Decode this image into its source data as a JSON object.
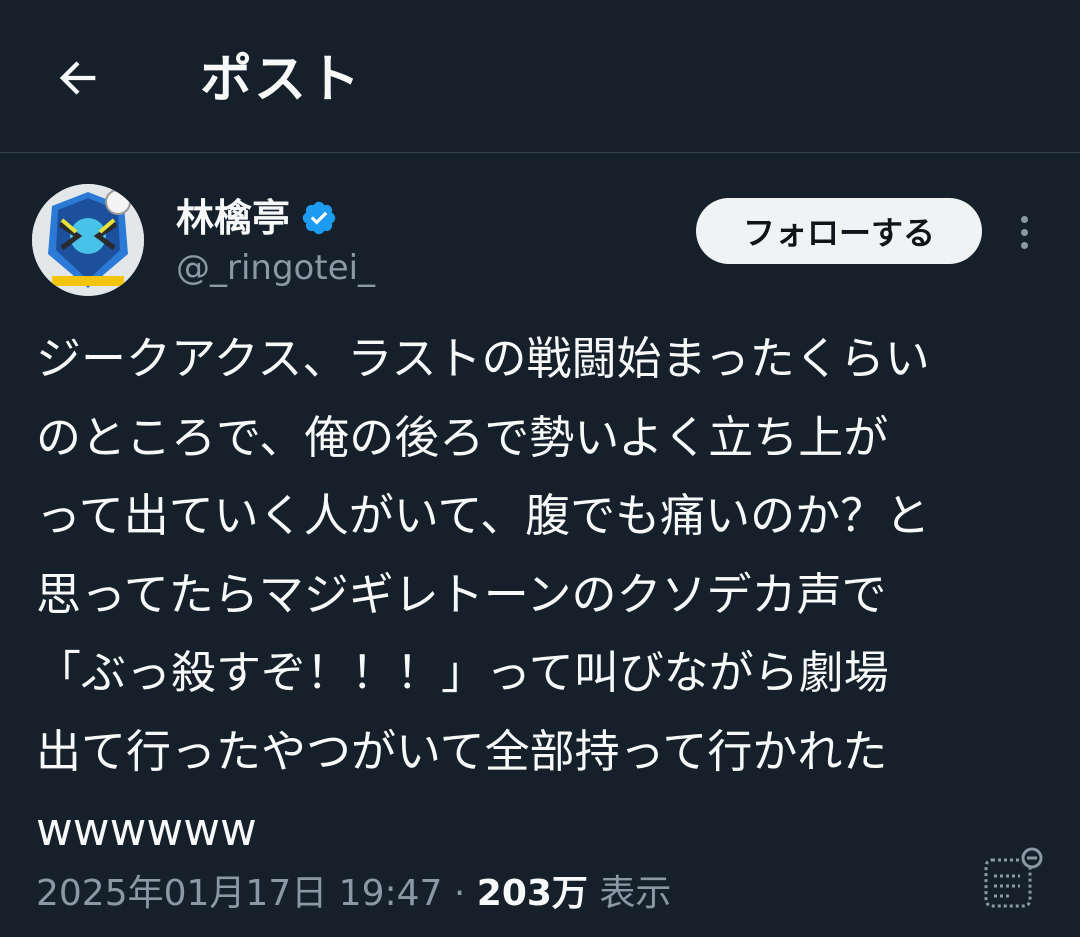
{
  "header": {
    "back_icon": "arrow-left-icon",
    "title": "ポスト"
  },
  "author": {
    "display_name": "林檎亭",
    "handle": "@_ringotei_",
    "verified": true,
    "verified_color": "#1d9bf0"
  },
  "actions": {
    "follow_label": "フォローする",
    "more_icon": "more-vertical-icon"
  },
  "tweet": {
    "lines": [
      "ジークアクス、ラストの戦闘始まったくらい",
      "のところで、俺の後ろで勢いよく立ち上が",
      "って出ていく人がいて、腹でも痛いのか？と",
      "思ってたらマジギレトーンのクソデカ声で",
      "「ぶっ殺すぞ！！！」って叫びながら劇場",
      "出て行ったやつがいて全部持って行かれた",
      "wwwwww"
    ]
  },
  "meta": {
    "timestamp": "2025年01月17日 19:47",
    "separator": " · ",
    "views_count": "203万",
    "views_label": " 表示",
    "analytics_icon": "analytics-icon"
  },
  "colors": {
    "background": "#15202b",
    "text_primary": "#f7f9f9",
    "text_secondary": "#8b98a5",
    "divider": "#38444d"
  }
}
